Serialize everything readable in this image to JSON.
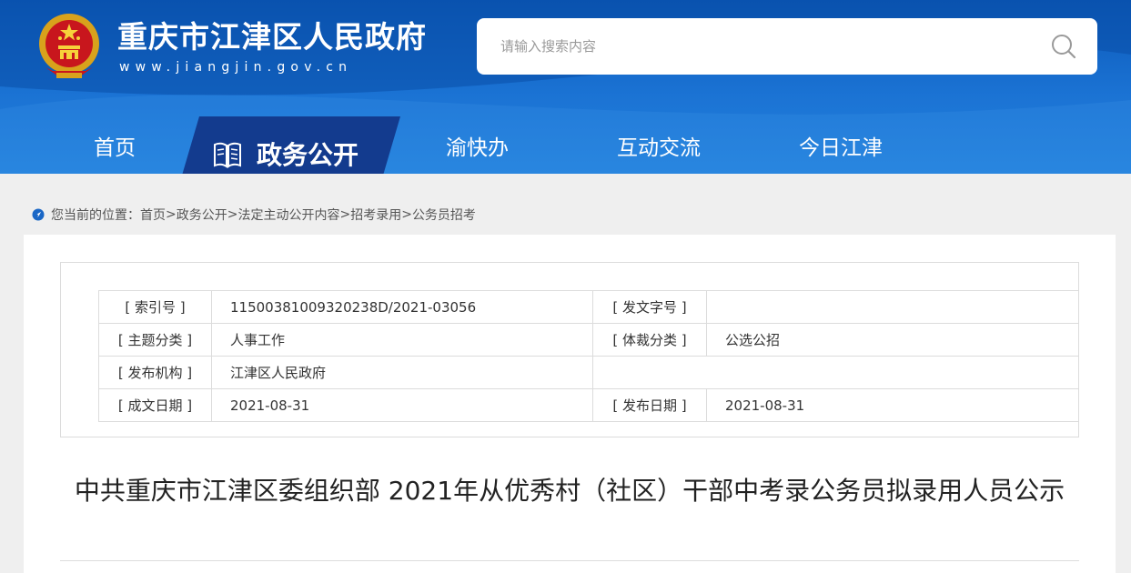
{
  "header": {
    "site_title": "重庆市江津区人民政府",
    "site_url": "www.jiangjin.gov.cn",
    "emblem_icon": "national-emblem-icon",
    "colors": {
      "primary": "#0b58b8",
      "nav_active": "#123a8f"
    }
  },
  "search": {
    "placeholder": "请输入搜索内容",
    "value": ""
  },
  "nav": {
    "items": [
      "首页",
      "政务公开",
      "渝快办",
      "互动交流",
      "今日江津"
    ],
    "active": "政务公开"
  },
  "breadcrumb": {
    "prefix": "您当前的位置：",
    "items": [
      "首页",
      "政务公开",
      "法定主动公开内容",
      "招考录用",
      "公务员招考"
    ],
    "separator": ">"
  },
  "meta": {
    "rows": [
      {
        "l1": "[ 索引号 ]",
        "v1": "11500381009320238D/2021-03056",
        "l2": "[ 发文字号 ]",
        "v2": ""
      },
      {
        "l1": "[ 主题分类 ]",
        "v1": "人事工作",
        "l2": "[ 体裁分类 ]",
        "v2": "公选公招"
      },
      {
        "l1": "[ 发布机构 ]",
        "v1": "江津区人民政府",
        "l2": "",
        "v2": ""
      },
      {
        "l1": "[ 成文日期 ]",
        "v1": "2021-08-31",
        "l2": "[ 发布日期 ]",
        "v2": "2021-08-31"
      }
    ]
  },
  "article": {
    "title": "中共重庆市江津区委组织部 2021年从优秀村（社区）干部中考录公务员拟录用人员公示"
  }
}
